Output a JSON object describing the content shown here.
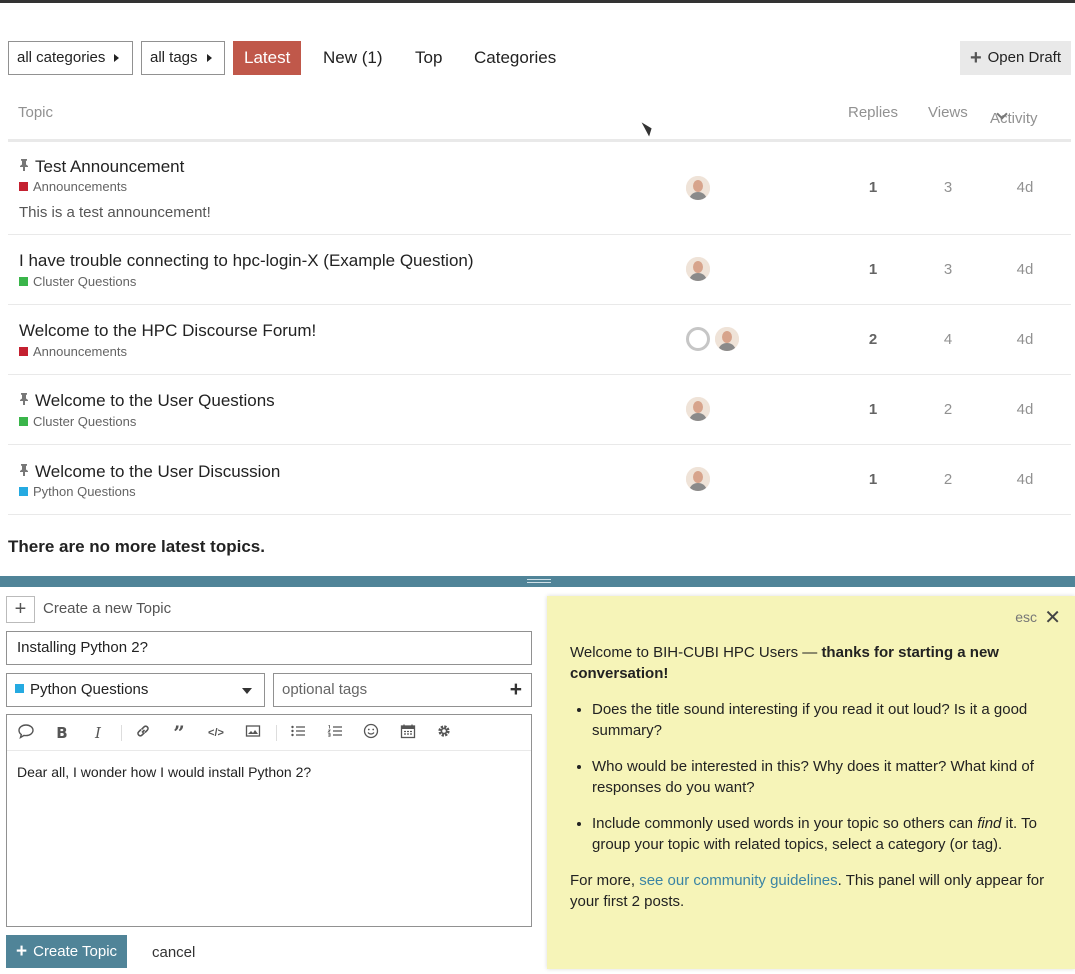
{
  "nav": {
    "categories_dropdown": "all categories",
    "tags_dropdown": "all tags",
    "tabs": [
      {
        "label": "Latest",
        "active": true
      },
      {
        "label": "New (1)",
        "active": false
      },
      {
        "label": "Top",
        "active": false
      },
      {
        "label": "Categories",
        "active": false
      }
    ],
    "open_draft": "Open Draft"
  },
  "list_header": {
    "topic": "Topic",
    "replies": "Replies",
    "views": "Views",
    "activity": "Activity"
  },
  "topics": [
    {
      "title": "Test Announcement",
      "pinned": true,
      "category": "Announcements",
      "category_color": "#c42030",
      "excerpt": "This is a test announcement!",
      "replies": "1",
      "views": "3",
      "activity": "4d"
    },
    {
      "title": "I have trouble connecting to hpc-login-X (Example Question)",
      "pinned": false,
      "category": "Cluster Questions",
      "category_color": "#3ab54a",
      "replies": "1",
      "views": "3",
      "activity": "4d"
    },
    {
      "title": "Welcome to the HPC Discourse Forum!",
      "pinned": false,
      "category": "Announcements",
      "category_color": "#c42030",
      "replies": "2",
      "views": "4",
      "activity": "4d"
    },
    {
      "title": "Welcome to the User Questions",
      "pinned": true,
      "category": "Cluster Questions",
      "category_color": "#3ab54a",
      "replies": "1",
      "views": "2",
      "activity": "4d"
    },
    {
      "title": "Welcome to the User Discussion",
      "pinned": true,
      "category": "Python Questions",
      "category_color": "#25aae1",
      "replies": "1",
      "views": "2",
      "activity": "4d"
    }
  ],
  "no_more": "There are no more latest topics.",
  "composer": {
    "action": "Create a new Topic",
    "title_value": "Installing Python 2?",
    "category": "Python Questions",
    "category_color": "#25aae1",
    "tags_placeholder": "optional tags",
    "body": "Dear all, I wonder how I would install Python 2?",
    "create_button": "Create Topic",
    "cancel": "cancel",
    "toolbar_icons": [
      "quote-icon",
      "bold-icon",
      "italic-icon",
      "link-icon",
      "blockquote-icon",
      "code-icon",
      "image-icon",
      "bullet-list-icon",
      "numbered-list-icon",
      "emoji-icon",
      "calendar-icon",
      "gear-icon"
    ]
  },
  "tip": {
    "esc": "esc",
    "intro_plain": "Welcome to BIH-CUBI HPC Users — ",
    "intro_bold": "thanks for starting a new conversation!",
    "bullet1": "Does the title sound interesting if you read it out loud? Is it a good summary?",
    "bullet2": "Who would be interested in this? Why does it matter? What kind of responses do you want?",
    "bullet3_before": "Include commonly used words in your topic so others can ",
    "bullet3_em": "find",
    "bullet3_after": " it. To group your topic with related topics, select a category (or tag).",
    "more_before": "For more, ",
    "more_link": "see our community guidelines",
    "more_after": ". This panel will only appear for your first 2 posts."
  }
}
